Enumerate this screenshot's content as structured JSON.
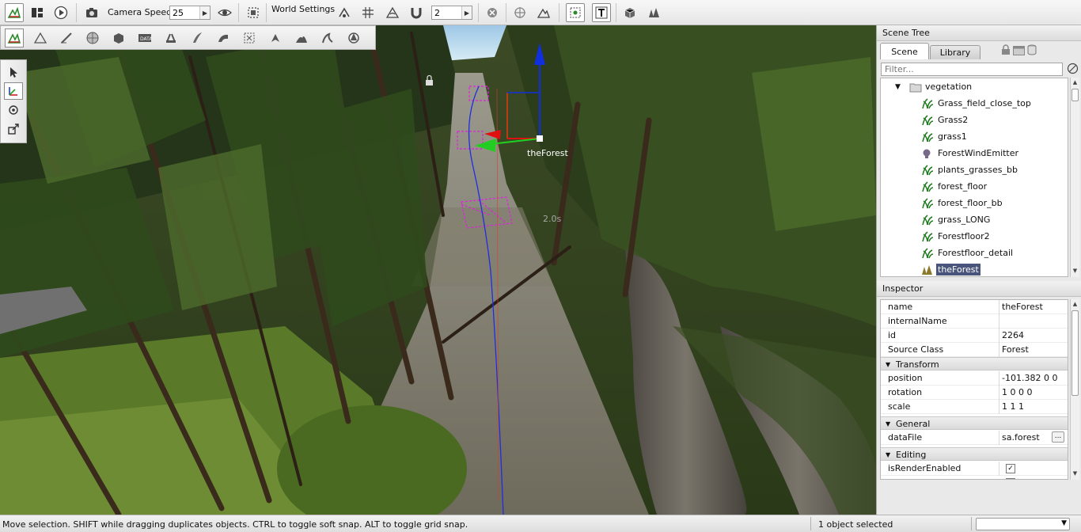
{
  "toolbar": {
    "camera_speed_label": "Camera Speed",
    "camera_speed_value": "25",
    "world_settings_label": "World Settings",
    "snap_value": "2",
    "icons": [
      "world-editor-icon",
      "layout-icon",
      "play-icon",
      "camera-icon",
      "eye-icon",
      "fit-view-icon",
      "snap-icon",
      "grid-icon",
      "rotate-snap-icon",
      "magnet-icon",
      "select-icon",
      "center-icon",
      "terrain-icon",
      "bounds-icon",
      "text-icon",
      "material-icon",
      "forest-icon"
    ]
  },
  "palette": {
    "icons": [
      "object-editor-icon",
      "terrain-editor-icon",
      "terrain-painter-icon",
      "sphere-icon",
      "mesh-icon",
      "data-icon",
      "road-icon",
      "river-icon",
      "decal-icon",
      "navmesh-icon",
      "particle-icon",
      "forest-tool-icon",
      "wind-icon",
      "mesh-road-icon"
    ],
    "side_icons": [
      "arrow-select-icon",
      "move-gizmo-icon",
      "rotate-gizmo-icon",
      "scale-gizmo-icon"
    ]
  },
  "viewport": {
    "object_label": "theForest",
    "distance_label": "2.0s"
  },
  "scene_tree": {
    "title": "Scene Tree",
    "tabs": [
      "Scene",
      "Library"
    ],
    "filter_placeholder": "Filter...",
    "items": [
      {
        "label": "vegetation",
        "icon": "folder-icon"
      },
      {
        "label": "Grass_field_close_top",
        "icon": "grass-icon"
      },
      {
        "label": "Grass2",
        "icon": "grass-icon"
      },
      {
        "label": "grass1",
        "icon": "grass-icon"
      },
      {
        "label": "ForestWindEmitter",
        "icon": "wind-emitter-icon"
      },
      {
        "label": "plants_grasses_bb",
        "icon": "grass-icon"
      },
      {
        "label": "forest_floor",
        "icon": "grass-icon"
      },
      {
        "label": "forest_floor_bb",
        "icon": "grass-icon"
      },
      {
        "label": "grass_LONG",
        "icon": "grass-icon"
      },
      {
        "label": "Forestfloor2",
        "icon": "grass-icon"
      },
      {
        "label": "Forestfloor_detail",
        "icon": "grass-icon"
      },
      {
        "label": "theForest",
        "icon": "forest-icon"
      }
    ]
  },
  "inspector": {
    "title": "Inspector",
    "fields": [
      {
        "key": "name",
        "value": "theForest"
      },
      {
        "key": "internalName",
        "value": ""
      },
      {
        "key": "id",
        "value": "2264"
      },
      {
        "key": "Source Class",
        "value": "Forest"
      }
    ],
    "groups": {
      "transform": "Transform",
      "general": "General",
      "editing": "Editing"
    },
    "transform": [
      {
        "key": "position",
        "value": "-101.382 0 0"
      },
      {
        "key": "rotation",
        "value": "1 0 0 0"
      },
      {
        "key": "scale",
        "value": "1 1 1"
      }
    ],
    "general": {
      "key": "dataFile",
      "value": "sa.forest",
      "button": "..."
    },
    "editing": {
      "key": "isRenderEnabled",
      "checked": true
    }
  },
  "status": {
    "message": "Move selection.  SHIFT while dragging duplicates objects.  CTRL to toggle soft snap.  ALT to toggle grid snap.",
    "selection": "1 object selected",
    "combo_value": ""
  },
  "colors": {
    "selection": "#49557a",
    "gizmo_x": "#e01010",
    "gizmo_y": "#22cc22",
    "gizmo_z": "#1030e0",
    "bounds": "#e020e0"
  }
}
